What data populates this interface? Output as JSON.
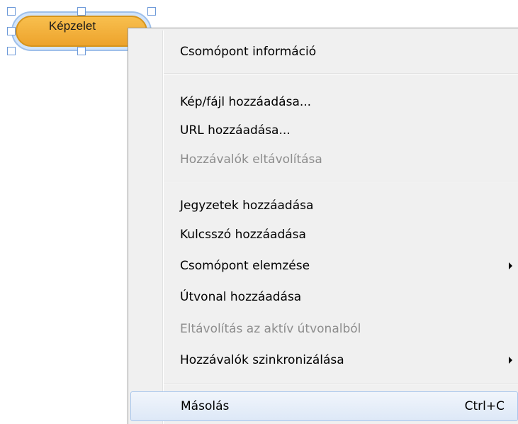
{
  "node": {
    "label": "Képzelet"
  },
  "menu": {
    "items": [
      {
        "label": "Csomópont információ"
      },
      {
        "label": "Kép/fájl hozzáadása..."
      },
      {
        "label": "URL hozzáadása..."
      },
      {
        "label": "Hozzávalók eltávolítása"
      },
      {
        "label": "Jegyzetek hozzáadása"
      },
      {
        "label": "Kulcsszó hozzáadása"
      },
      {
        "label": "Csomópont elemzése"
      },
      {
        "label": "Útvonal hozzáadása"
      },
      {
        "label": "Eltávolítás az aktív útvonalból"
      },
      {
        "label": "Hozzávalók szinkronizálása"
      },
      {
        "label": "Másolás",
        "shortcut": "Ctrl+C"
      }
    ]
  },
  "colors": {
    "node_fill": "#f0a832",
    "node_border": "#d6941c",
    "selection": "#9fc0ea",
    "menu_bg": "#f0f0f0",
    "hover_border": "#a8c6ec",
    "disabled_text": "#8d8d8d"
  }
}
